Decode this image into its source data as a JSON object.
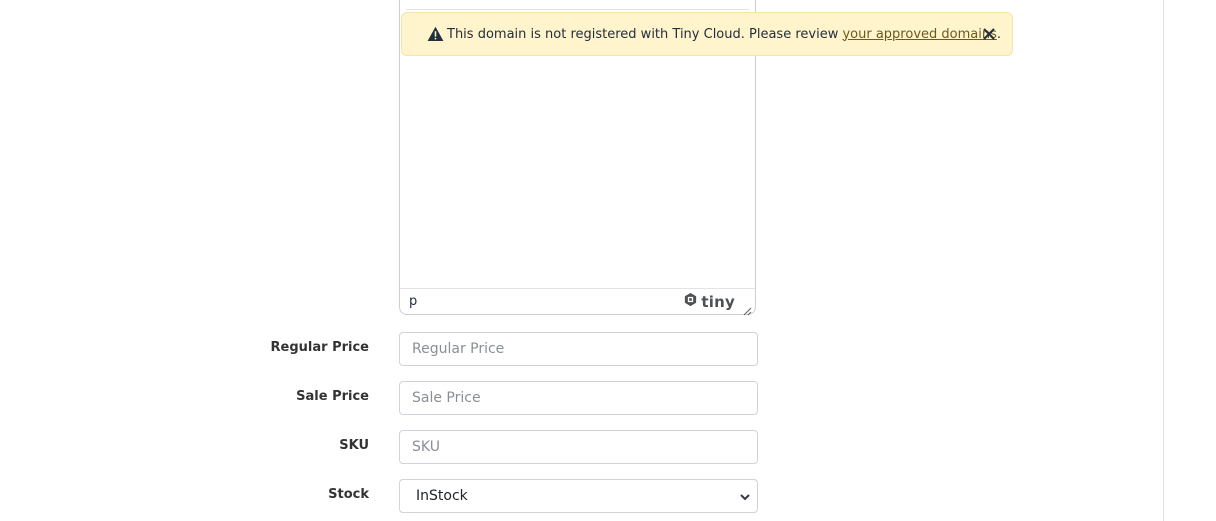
{
  "editor": {
    "status_path": "p",
    "brand_text": "tiny"
  },
  "notification": {
    "message": "This domain is not registered with Tiny Cloud. Please review ",
    "link_text": "your approved domains",
    "suffix": "."
  },
  "form": {
    "regular_price": {
      "label": "Regular Price",
      "placeholder": "Regular Price",
      "value": ""
    },
    "sale_price": {
      "label": "Sale Price",
      "placeholder": "Sale Price",
      "value": ""
    },
    "sku": {
      "label": "SKU",
      "placeholder": "SKU",
      "value": ""
    },
    "stock": {
      "label": "Stock",
      "selected": "InStock"
    }
  },
  "icons": {
    "warning": "warning-icon",
    "close": "close-icon",
    "tiny_logo": "tiny-logo-icon",
    "resize": "resize-handle-icon",
    "caret": "chevron-down-icon"
  },
  "colors": {
    "notification_bg": "#fff4cc",
    "border": "#ced4da",
    "label": "#333333"
  }
}
